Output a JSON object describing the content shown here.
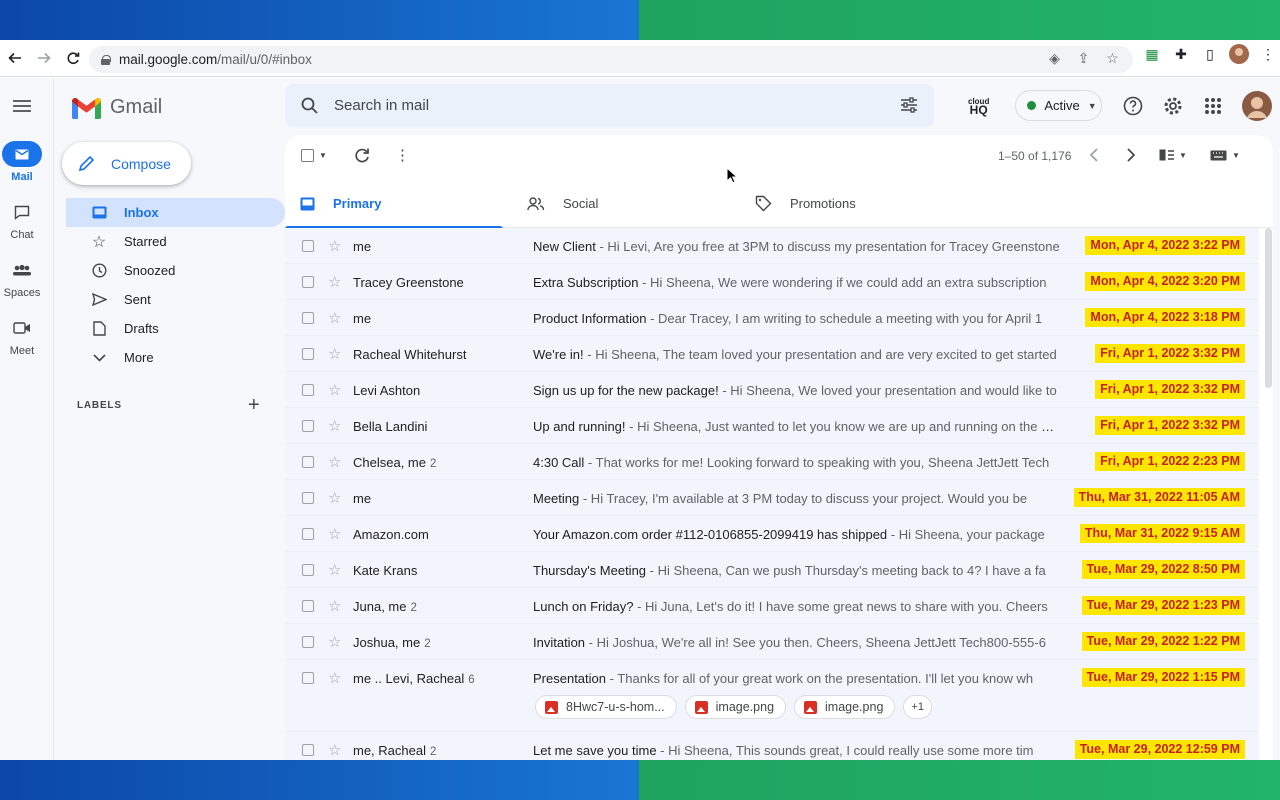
{
  "browser": {
    "url_host": "mail.google.com",
    "url_path": "/mail/u/0/#inbox"
  },
  "rail": [
    {
      "label": "Mail",
      "icon": "mail-icon",
      "active": true
    },
    {
      "label": "Chat",
      "icon": "chat-icon",
      "active": false
    },
    {
      "label": "Spaces",
      "icon": "spaces-icon",
      "active": false
    },
    {
      "label": "Meet",
      "icon": "meet-icon",
      "active": false
    }
  ],
  "app": {
    "name": "Gmail",
    "compose_label": "Compose",
    "labels_heading": "LABELS"
  },
  "nav": [
    {
      "label": "Inbox",
      "icon": "inbox-icon",
      "active": true
    },
    {
      "label": "Starred",
      "icon": "star-icon"
    },
    {
      "label": "Snoozed",
      "icon": "clock-icon"
    },
    {
      "label": "Sent",
      "icon": "send-icon"
    },
    {
      "label": "Drafts",
      "icon": "draft-icon"
    },
    {
      "label": "More",
      "icon": "chevron-down-icon"
    }
  ],
  "search": {
    "placeholder": "Search in mail"
  },
  "header": {
    "cloudhq_top": "cloud",
    "cloudhq_bottom": "HQ",
    "status": "Active"
  },
  "toolbar": {
    "page_info": "1–50 of 1,176"
  },
  "tabs": [
    {
      "label": "Primary",
      "icon": "inbox-icon",
      "active": true
    },
    {
      "label": "Social",
      "icon": "people-icon"
    },
    {
      "label": "Promotions",
      "icon": "tag-icon"
    }
  ],
  "emails": [
    {
      "sender": "me",
      "count": "",
      "subject": "New Client",
      "snippet": " - Hi Levi, Are you free at 3PM to discuss my presentation for Tracey Greenstone",
      "date": "Mon, Apr 4, 2022 3:22 PM"
    },
    {
      "sender": "Tracey Greenstone",
      "count": "",
      "subject": "Extra Subscription",
      "snippet": " - Hi Sheena, We were wondering if we could add an extra subscription",
      "date": "Mon, Apr 4, 2022 3:20 PM"
    },
    {
      "sender": "me",
      "count": "",
      "subject": "Product Information",
      "snippet": " - Dear Tracey, I am writing to schedule a meeting with you for April 1",
      "date": "Mon, Apr 4, 2022 3:18 PM"
    },
    {
      "sender": "Racheal Whitehurst",
      "count": "",
      "subject": "We're in!",
      "snippet": " - Hi Sheena, The team loved your presentation and are very excited to get started",
      "date": "Fri, Apr 1, 2022 3:32 PM"
    },
    {
      "sender": "Levi Ashton",
      "count": "",
      "subject": "Sign us up for the new package!",
      "snippet": " - Hi Sheena, We loved your presentation and would like to",
      "date": "Fri, Apr 1, 2022 3:32 PM"
    },
    {
      "sender": "Bella Landini",
      "count": "",
      "subject": "Up and running!",
      "snippet": " - Hi Sheena, Just wanted to let you know we are up and running on the new",
      "date": "Fri, Apr 1, 2022 3:32 PM"
    },
    {
      "sender": "Chelsea, me",
      "count": "2",
      "subject": "4:30 Call",
      "snippet": " - That works for me! Looking forward to speaking with you, Sheena JettJett Tech",
      "date": "Fri, Apr 1, 2022 2:23 PM"
    },
    {
      "sender": "me",
      "count": "",
      "subject": "Meeting",
      "snippet": " - Hi Tracey, I'm available at 3 PM today to discuss your project. Would you be",
      "date": "Thu, Mar 31, 2022 11:05 AM"
    },
    {
      "sender": "Amazon.com",
      "count": "",
      "subject": "Your Amazon.com order #112-0106855-2099419 has shipped",
      "snippet": " - Hi Sheena, your package",
      "date": "Thu, Mar 31, 2022 9:15 AM"
    },
    {
      "sender": "Kate Krans",
      "count": "",
      "subject": "Thursday's Meeting",
      "snippet": " - Hi Sheena, Can we push Thursday's meeting back to 4? I have a fa",
      "date": "Tue, Mar 29, 2022 8:50 PM"
    },
    {
      "sender": "Juna, me",
      "count": "2",
      "subject": "Lunch on Friday?",
      "snippet": " - Hi Juna, Let's do it! I have some great news to share with you. Cheers",
      "date": "Tue, Mar 29, 2022 1:23 PM"
    },
    {
      "sender": "Joshua, me",
      "count": "2",
      "subject": "Invitation",
      "snippet": " - Hi Joshua, We're all in! See you then. Cheers, Sheena JettJett Tech800-555-6",
      "date": "Tue, Mar 29, 2022 1:22 PM"
    },
    {
      "sender": "me .. Levi, Racheal",
      "count": "6",
      "subject": "Presentation",
      "snippet": " - Thanks for all of your great work on the presentation. I'll let you know wh",
      "date": "Tue, Mar 29, 2022 1:15 PM",
      "attachments": [
        "8Hwc7-u-s-hom...",
        "image.png",
        "image.png"
      ],
      "more_attachments": "+1"
    },
    {
      "sender": "me, Racheal",
      "count": "2",
      "subject": "Let me save you time",
      "snippet": " - Hi Sheena, This sounds great, I could really use some more tim",
      "date": "Tue, Mar 29, 2022 12:59 PM"
    }
  ]
}
